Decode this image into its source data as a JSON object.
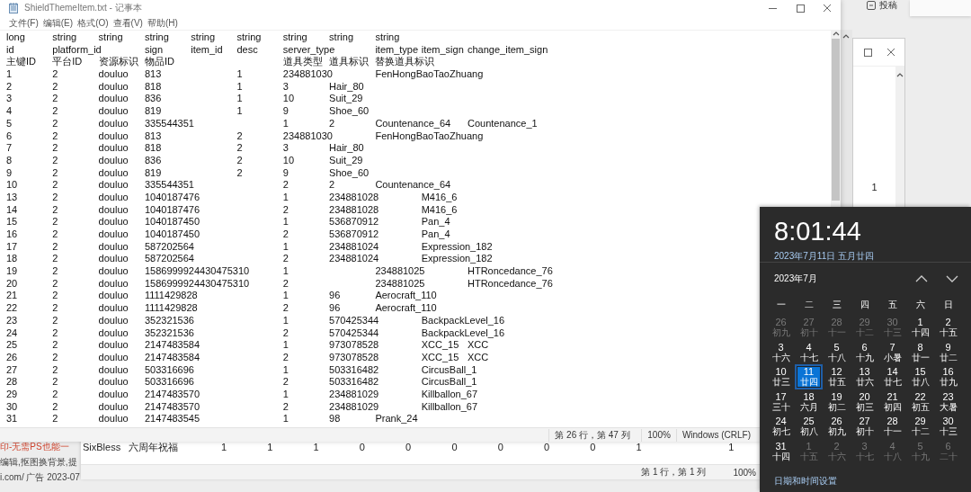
{
  "notepad": {
    "title": "ShieldThemeItem.txt - 记事本",
    "menu": [
      "文件(F)",
      "编辑(E)",
      "格式(O)",
      "查看(V)",
      "帮助(H)"
    ],
    "lines": [
      "long\tstring\tstring\tstring\tstring\tstring\tstring\tstring\tstring",
      "id\tplatform_id\tsign\titem_id\tdesc\tserver_type\titem_type\titem_sign\tchange_item_sign",
      "主键ID\t平台ID\t资源标识\t物品ID\t\t\t道具类型\t道具标识\t替换道具标识",
      "1\t2\tdouluo\t813\t\t1\t234881030\tFenHongBaoTaoZhuang",
      "2\t2\tdouluo\t818\t\t1\t3\tHair_80",
      "3\t2\tdouluo\t836\t\t1\t10\tSuit_29",
      "4\t2\tdouluo\t819\t\t1\t9\tShoe_60",
      "5\t2\tdouluo\t335544351\t\t1\t2\tCountenance_64\tCountenance_1",
      "6\t2\tdouluo\t813\t\t2\t234881030\tFenHongBaoTaoZhuang",
      "7\t2\tdouluo\t818\t\t2\t3\tHair_80",
      "8\t2\tdouluo\t836\t\t2\t10\tSuit_29",
      "9\t2\tdouluo\t819\t\t2\t9\tShoe_60",
      "10\t2\tdouluo\t335544351\t\t2\t2\tCountenance_64",
      "13\t2\tdouluo\t1040187476\t\t1\t234881028\tM416_6",
      "14\t2\tdouluo\t1040187476\t\t2\t234881028\tM416_6",
      "15\t2\tdouluo\t1040187450\t\t1\t536870912\tPan_4",
      "16\t2\tdouluo\t1040187450\t\t2\t536870912\tPan_4",
      "17\t2\tdouluo\t587202564\t\t1\t234881024\tExpression_182",
      "18\t2\tdouluo\t587202564\t\t2\t234881024\tExpression_182",
      "19\t2\tdouluo\t1586999924430475310\t1\t\t234881025\tHTRoncedance_76",
      "20\t2\tdouluo\t1586999924430475310\t2\t\t234881025\tHTRoncedance_76",
      "21\t2\tdouluo\t1111429828\t\t1\t96\tAerocraft_110",
      "22\t2\tdouluo\t1111429828\t\t2\t96\tAerocraft_110",
      "23\t2\tdouluo\t352321536\t\t1\t570425344\tBackpackLevel_16",
      "24\t2\tdouluo\t352321536\t\t2\t570425344\tBackpackLevel_16",
      "25\t2\tdouluo\t2147483584\t\t1\t973078528\tXCC_15\tXCC",
      "26\t2\tdouluo\t2147483584\t\t2\t973078528\tXCC_15\tXCC",
      "27\t2\tdouluo\t503316696\t\t1\t503316482\tCircusBall_1",
      "28\t2\tdouluo\t503316696\t\t2\t503316482\tCircusBall_1",
      "29\t2\tdouluo\t2147483570\t\t1\t234881029\tKillballon_67",
      "30\t2\tdouluo\t2147483570\t\t2\t234881029\tKillballon_67",
      "31\t2\tdouluo\t2147483545\t\t1\t98\tPrank_24"
    ],
    "status_bar": [
      "第 26 行，第 47 列",
      "100%",
      "Windows (CRLF)"
    ]
  },
  "sheet_window": {
    "line": "SixBless\t六周年祝福\t1\t1\t1\t0\t0\t0\t0\t0\t0\t1\t\t1",
    "status_bar": [
      "第 1 行，第 1 列",
      "100%"
    ]
  },
  "side_window": {
    "cell": "1"
  },
  "top_right": {
    "label": "投稿"
  },
  "background_ad": {
    "lines": [
      "印-无需PS也能一",
      "编辑,抠图换背景,提",
      "i.com/  广告  2023-07"
    ]
  },
  "clock_flyout": {
    "time": "8:01:44",
    "date": "2023年7月11日 五月廿四",
    "month": "2023年7月",
    "weekdays": [
      "一",
      "二",
      "三",
      "四",
      "五",
      "六",
      "日"
    ],
    "days": [
      {
        "day": "26",
        "lunar": "初九",
        "in_month": false,
        "selected": false
      },
      {
        "day": "27",
        "lunar": "初十",
        "in_month": false,
        "selected": false
      },
      {
        "day": "28",
        "lunar": "十一",
        "in_month": false,
        "selected": false
      },
      {
        "day": "29",
        "lunar": "十二",
        "in_month": false,
        "selected": false
      },
      {
        "day": "30",
        "lunar": "十三",
        "in_month": false,
        "selected": false
      },
      {
        "day": "1",
        "lunar": "十四",
        "in_month": true,
        "selected": false
      },
      {
        "day": "2",
        "lunar": "十五",
        "in_month": true,
        "selected": false
      },
      {
        "day": "3",
        "lunar": "十六",
        "in_month": true,
        "selected": false
      },
      {
        "day": "4",
        "lunar": "十七",
        "in_month": true,
        "selected": false
      },
      {
        "day": "5",
        "lunar": "十八",
        "in_month": true,
        "selected": false
      },
      {
        "day": "6",
        "lunar": "十九",
        "in_month": true,
        "selected": false
      },
      {
        "day": "7",
        "lunar": "小暑",
        "in_month": true,
        "selected": false
      },
      {
        "day": "8",
        "lunar": "廿一",
        "in_month": true,
        "selected": false
      },
      {
        "day": "9",
        "lunar": "廿二",
        "in_month": true,
        "selected": false
      },
      {
        "day": "10",
        "lunar": "廿三",
        "in_month": true,
        "selected": false
      },
      {
        "day": "11",
        "lunar": "廿四",
        "in_month": true,
        "selected": true
      },
      {
        "day": "12",
        "lunar": "廿五",
        "in_month": true,
        "selected": false
      },
      {
        "day": "13",
        "lunar": "廿六",
        "in_month": true,
        "selected": false
      },
      {
        "day": "14",
        "lunar": "廿七",
        "in_month": true,
        "selected": false
      },
      {
        "day": "15",
        "lunar": "廿八",
        "in_month": true,
        "selected": false
      },
      {
        "day": "16",
        "lunar": "廿九",
        "in_month": true,
        "selected": false
      },
      {
        "day": "17",
        "lunar": "三十",
        "in_month": true,
        "selected": false
      },
      {
        "day": "18",
        "lunar": "六月",
        "in_month": true,
        "selected": false
      },
      {
        "day": "19",
        "lunar": "初二",
        "in_month": true,
        "selected": false
      },
      {
        "day": "20",
        "lunar": "初三",
        "in_month": true,
        "selected": false
      },
      {
        "day": "21",
        "lunar": "初四",
        "in_month": true,
        "selected": false
      },
      {
        "day": "22",
        "lunar": "初五",
        "in_month": true,
        "selected": false
      },
      {
        "day": "23",
        "lunar": "大暑",
        "in_month": true,
        "selected": false
      },
      {
        "day": "24",
        "lunar": "初七",
        "in_month": true,
        "selected": false
      },
      {
        "day": "25",
        "lunar": "初八",
        "in_month": true,
        "selected": false
      },
      {
        "day": "26",
        "lunar": "初九",
        "in_month": true,
        "selected": false
      },
      {
        "day": "27",
        "lunar": "初十",
        "in_month": true,
        "selected": false
      },
      {
        "day": "28",
        "lunar": "十一",
        "in_month": true,
        "selected": false
      },
      {
        "day": "29",
        "lunar": "十二",
        "in_month": true,
        "selected": false
      },
      {
        "day": "30",
        "lunar": "十三",
        "in_month": true,
        "selected": false
      },
      {
        "day": "31",
        "lunar": "十四",
        "in_month": true,
        "selected": false
      },
      {
        "day": "1",
        "lunar": "十五",
        "in_month": false,
        "selected": false
      },
      {
        "day": "2",
        "lunar": "十六",
        "in_month": false,
        "selected": false
      },
      {
        "day": "3",
        "lunar": "十七",
        "in_month": false,
        "selected": false
      },
      {
        "day": "4",
        "lunar": "十八",
        "in_month": false,
        "selected": false
      },
      {
        "day": "5",
        "lunar": "十九",
        "in_month": false,
        "selected": false
      },
      {
        "day": "6",
        "lunar": "二十",
        "in_month": false,
        "selected": false
      }
    ],
    "settings_link": "日期和时间设置"
  }
}
